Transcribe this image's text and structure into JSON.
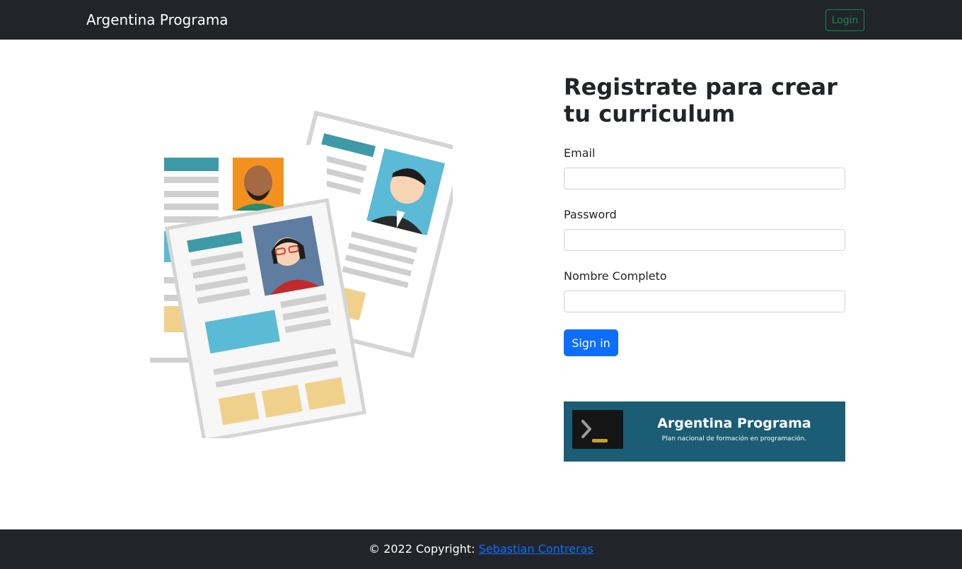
{
  "navbar": {
    "brand": "Argentina Programa",
    "login_label": "Login"
  },
  "form": {
    "title": "Registrate para crear tu curriculum",
    "email_label": "Email",
    "email_value": "",
    "password_label": "Password",
    "password_value": "",
    "name_label": "Nombre Completo",
    "name_value": "",
    "submit_label": "Sign in"
  },
  "banner": {
    "title": "Argentina Programa",
    "subtitle": "Plan nacional de formación en programación."
  },
  "footer": {
    "copyright": "© 2022 Copyright: ",
    "author": "Sebastian Contreras"
  },
  "icons": {
    "illustration": "resume-documents-illustration",
    "banner_logo": "terminal-prompt-icon"
  },
  "colors": {
    "navbar_bg": "#212529",
    "primary": "#0d6efd",
    "login_outline": "#198754",
    "banner_bg": "#1b5d74"
  }
}
